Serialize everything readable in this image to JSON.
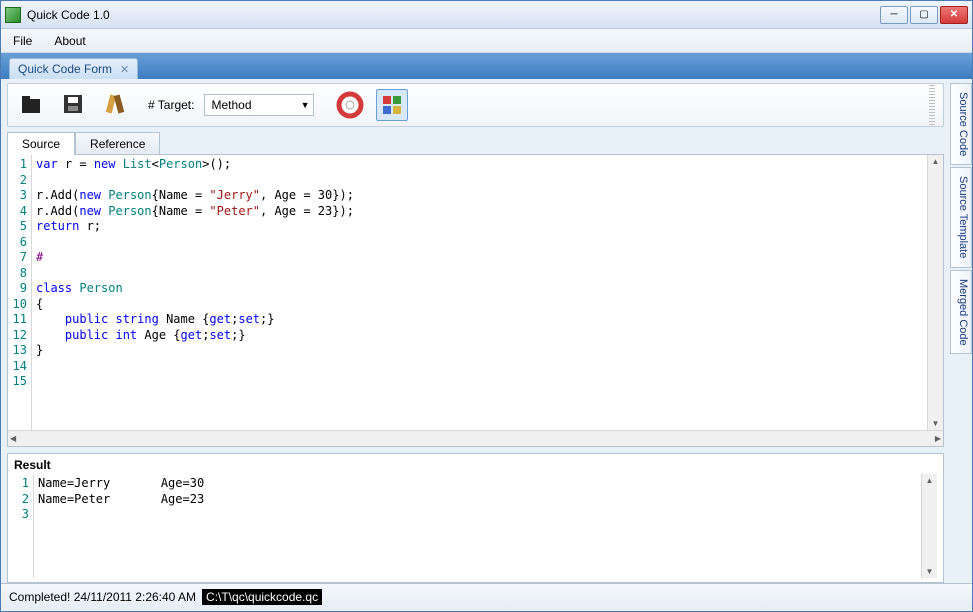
{
  "window": {
    "title": "Quick Code 1.0"
  },
  "menu": {
    "file": "File",
    "about": "About"
  },
  "docTab": {
    "label": "Quick Code Form"
  },
  "toolbar": {
    "targetLabel": "# Target:",
    "targetValue": "Method"
  },
  "codeTabs": {
    "source": "Source",
    "reference": "Reference"
  },
  "sideTabs": {
    "sourceCode": "Source Code",
    "sourceTemplate": "Source Template",
    "mergedCode": "Merged Code"
  },
  "editor": {
    "lines": 15,
    "code": [
      {
        "n": 1,
        "tokens": [
          {
            "t": "var ",
            "c": "kw"
          },
          {
            "t": "r = "
          },
          {
            "t": "new ",
            "c": "kw"
          },
          {
            "t": "List",
            "c": "type"
          },
          {
            "t": "<"
          },
          {
            "t": "Person",
            "c": "type"
          },
          {
            "t": ">();"
          }
        ]
      },
      {
        "n": 2,
        "tokens": []
      },
      {
        "n": 3,
        "tokens": [
          {
            "t": "r.Add("
          },
          {
            "t": "new ",
            "c": "kw"
          },
          {
            "t": "Person",
            "c": "type"
          },
          {
            "t": "{Name = "
          },
          {
            "t": "\"Jerry\"",
            "c": "str"
          },
          {
            "t": ", Age = 30});"
          }
        ]
      },
      {
        "n": 4,
        "tokens": [
          {
            "t": "r.Add("
          },
          {
            "t": "new ",
            "c": "kw"
          },
          {
            "t": "Person",
            "c": "type"
          },
          {
            "t": "{Name = "
          },
          {
            "t": "\"Peter\"",
            "c": "str"
          },
          {
            "t": ", Age = 23});"
          }
        ]
      },
      {
        "n": 5,
        "tokens": [
          {
            "t": "return ",
            "c": "kw"
          },
          {
            "t": "r;"
          }
        ]
      },
      {
        "n": 6,
        "tokens": []
      },
      {
        "n": 7,
        "tokens": [
          {
            "t": "#",
            "c": "prep"
          }
        ]
      },
      {
        "n": 8,
        "tokens": []
      },
      {
        "n": 9,
        "tokens": [
          {
            "t": "class ",
            "c": "kw"
          },
          {
            "t": "Person",
            "c": "type"
          }
        ]
      },
      {
        "n": 10,
        "tokens": [
          {
            "t": "{"
          }
        ]
      },
      {
        "n": 11,
        "tokens": [
          {
            "t": "    "
          },
          {
            "t": "public ",
            "c": "kw"
          },
          {
            "t": "string ",
            "c": "kw"
          },
          {
            "t": "Name {"
          },
          {
            "t": "get",
            "c": "kw"
          },
          {
            "t": ";"
          },
          {
            "t": "set",
            "c": "kw"
          },
          {
            "t": ";}"
          }
        ]
      },
      {
        "n": 12,
        "tokens": [
          {
            "t": "    "
          },
          {
            "t": "public ",
            "c": "kw"
          },
          {
            "t": "int ",
            "c": "kw"
          },
          {
            "t": "Age {"
          },
          {
            "t": "get",
            "c": "kw"
          },
          {
            "t": ";"
          },
          {
            "t": "set",
            "c": "kw"
          },
          {
            "t": ";}"
          }
        ]
      },
      {
        "n": 13,
        "tokens": [
          {
            "t": "}"
          }
        ]
      },
      {
        "n": 14,
        "tokens": []
      },
      {
        "n": 15,
        "tokens": []
      }
    ]
  },
  "result": {
    "title": "Result",
    "lines": [
      {
        "n": 1,
        "t": "Name=Jerry       Age=30"
      },
      {
        "n": 2,
        "t": "Name=Peter       Age=23"
      },
      {
        "n": 3,
        "t": ""
      }
    ]
  },
  "status": {
    "completed": "Completed! 24/11/2011 2:26:40 AM",
    "path": "C:\\T\\qc\\quickcode.qc"
  }
}
